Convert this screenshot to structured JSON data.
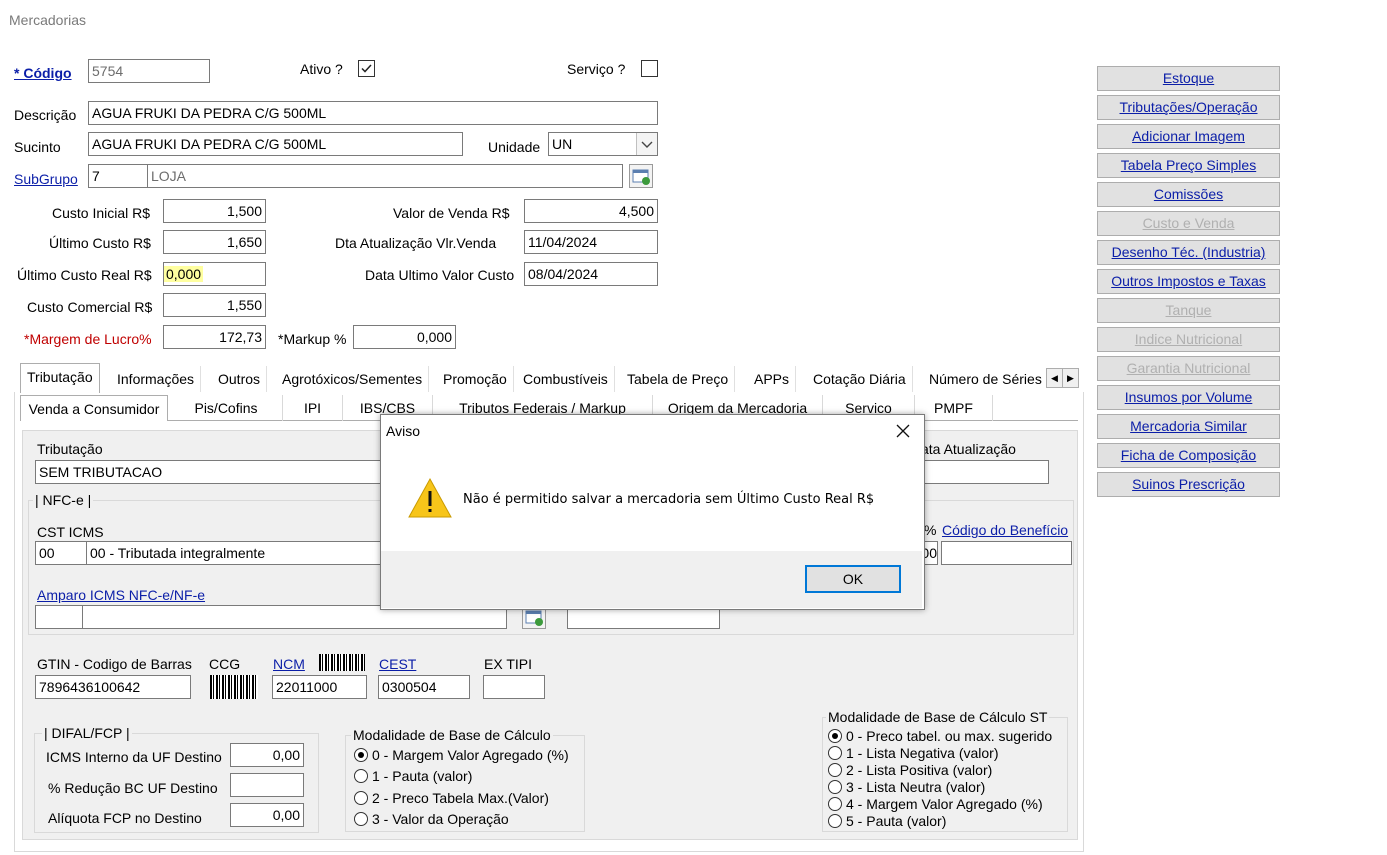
{
  "window": {
    "title": "Mercadorias"
  },
  "form": {
    "codigo_label": "* Código",
    "codigo_value": "5754",
    "ativo_label": "Ativo ?",
    "ativo_checked": true,
    "servico_label": "Serviço ?",
    "servico_checked": false,
    "descricao_label": "Descrição",
    "descricao_value": "AGUA FRUKI DA PEDRA C/G 500ML",
    "sucinto_label": "Sucinto",
    "sucinto_value": "AGUA FRUKI DA PEDRA C/G 500ML",
    "unidade_label": "Unidade",
    "unidade_value": "UN",
    "subgrupo_label": "SubGrupo",
    "subgrupo_code": "7",
    "subgrupo_name": "LOJA",
    "custo_inicial_label": "Custo Inicial R$",
    "custo_inicial_value": "1,500",
    "ultimo_custo_label": "Último Custo R$",
    "ultimo_custo_value": "1,650",
    "ultimo_custo_real_label": "Último Custo Real R$",
    "ultimo_custo_real_value": "0,000",
    "custo_comercial_label": "Custo Comercial R$",
    "custo_comercial_value": "1,550",
    "margem_label": "*Margem de Lucro%",
    "margem_value": "172,73",
    "markup_label": "*Markup %",
    "markup_value": "0,000",
    "valor_venda_label": "Valor de Venda R$",
    "valor_venda_value": "4,500",
    "dta_atualizacao_label": "Dta Atualização Vlr.Venda",
    "dta_atualizacao_value": "11/04/2024",
    "data_ultimo_custo_label": "Data Ultimo Valor Custo",
    "data_ultimo_custo_value": "08/04/2024"
  },
  "tabs": [
    "Tributação",
    "Informações",
    "Outros",
    "Agrotóxicos/Sementes",
    "Promoção",
    "Combustíveis",
    "Tabela de Preço",
    "APPs",
    "Cotação Diária",
    "Número de Séries"
  ],
  "subtabs": [
    "Venda a Consumidor",
    "Pis/Cofins",
    "IPI",
    "IBS/CBS",
    "Tributos Federais / Markup",
    "Origem da Mercadoria",
    "Servico",
    "PMPF"
  ],
  "trib": {
    "tributacao_label": "Tributação",
    "tributacao_value": "SEM TRIBUTACAO",
    "data_atualizacao_label": "ata Atualização",
    "nfce_group": "| NFC-e |",
    "cst_label": "CST ICMS",
    "cst_code": "00",
    "cst_desc": "00 - Tributada integralmente",
    "pct_symbol": "%",
    "pct_value_fragment": "00",
    "beneficio_label": "Código do Benefício",
    "amparo_label": "Amparo ICMS NFC-e/NF-e",
    "gtin_label": "GTIN - Codigo de Barras",
    "gtin_value": "7896436100642",
    "ccg_label": "CCG",
    "ncm_label": "NCM",
    "ncm_value": "22011000",
    "cest_label": "CEST",
    "cest_value": "0300504",
    "extipi_label": "EX TIPI",
    "extipi_value": "",
    "difal_group": "| DIFAL/FCP |",
    "icms_interno_label": "ICMS Interno da UF Destino",
    "icms_interno_value": "0,00",
    "reducao_label": "% Redução BC UF Destino",
    "reducao_value": "",
    "aliquota_fcp_label": "Alíquota FCP no Destino",
    "aliquota_fcp_value": "0,00",
    "modalidade_title": "Modalidade de Base de Cálculo",
    "modalidade_options": [
      "0 - Margem Valor Agregado (%)",
      "1 - Pauta (valor)",
      "2 - Preco Tabela Max.(Valor)",
      "3 - Valor da Operação"
    ],
    "modalidade_selected": 0,
    "modalidade_st_title": "Modalidade de Base de Cálculo ST",
    "modalidade_st_options": [
      "0 - Preco tabel. ou max. sugerido",
      "1 - Lista Negativa (valor)",
      "2 - Lista Positiva (valor)",
      "3 - Lista Neutra (valor)",
      "4 - Margem Valor Agregado (%)",
      "5 - Pauta (valor)"
    ],
    "modalidade_st_selected": 0
  },
  "sidebar": {
    "buttons": [
      {
        "label": "Estoque",
        "enabled": true
      },
      {
        "label": "Tributações/Operação",
        "enabled": true
      },
      {
        "label": "Adicionar Imagem",
        "enabled": true
      },
      {
        "label": "Tabela Preço Simples",
        "enabled": true
      },
      {
        "label": "Comissões",
        "enabled": true
      },
      {
        "label": "Custo e Venda",
        "enabled": false
      },
      {
        "label": "Desenho Téc. (Industria)",
        "enabled": true
      },
      {
        "label": "Outros Impostos e Taxas",
        "enabled": true
      },
      {
        "label": "Tanque",
        "enabled": false
      },
      {
        "label": "Indice Nutricional",
        "enabled": false
      },
      {
        "label": "Garantia Nutricional",
        "enabled": false
      },
      {
        "label": "Insumos por Volume",
        "enabled": true
      },
      {
        "label": "Mercadoria Similar",
        "enabled": true
      },
      {
        "label": "Ficha de Composição",
        "enabled": true
      },
      {
        "label": "Suinos Prescrição",
        "enabled": true
      }
    ]
  },
  "dialog": {
    "title": "Aviso",
    "message": "Não é permitido salvar a mercadoria sem Último Custo Real R$",
    "ok_label": "OK",
    "icon": "warning-icon"
  }
}
